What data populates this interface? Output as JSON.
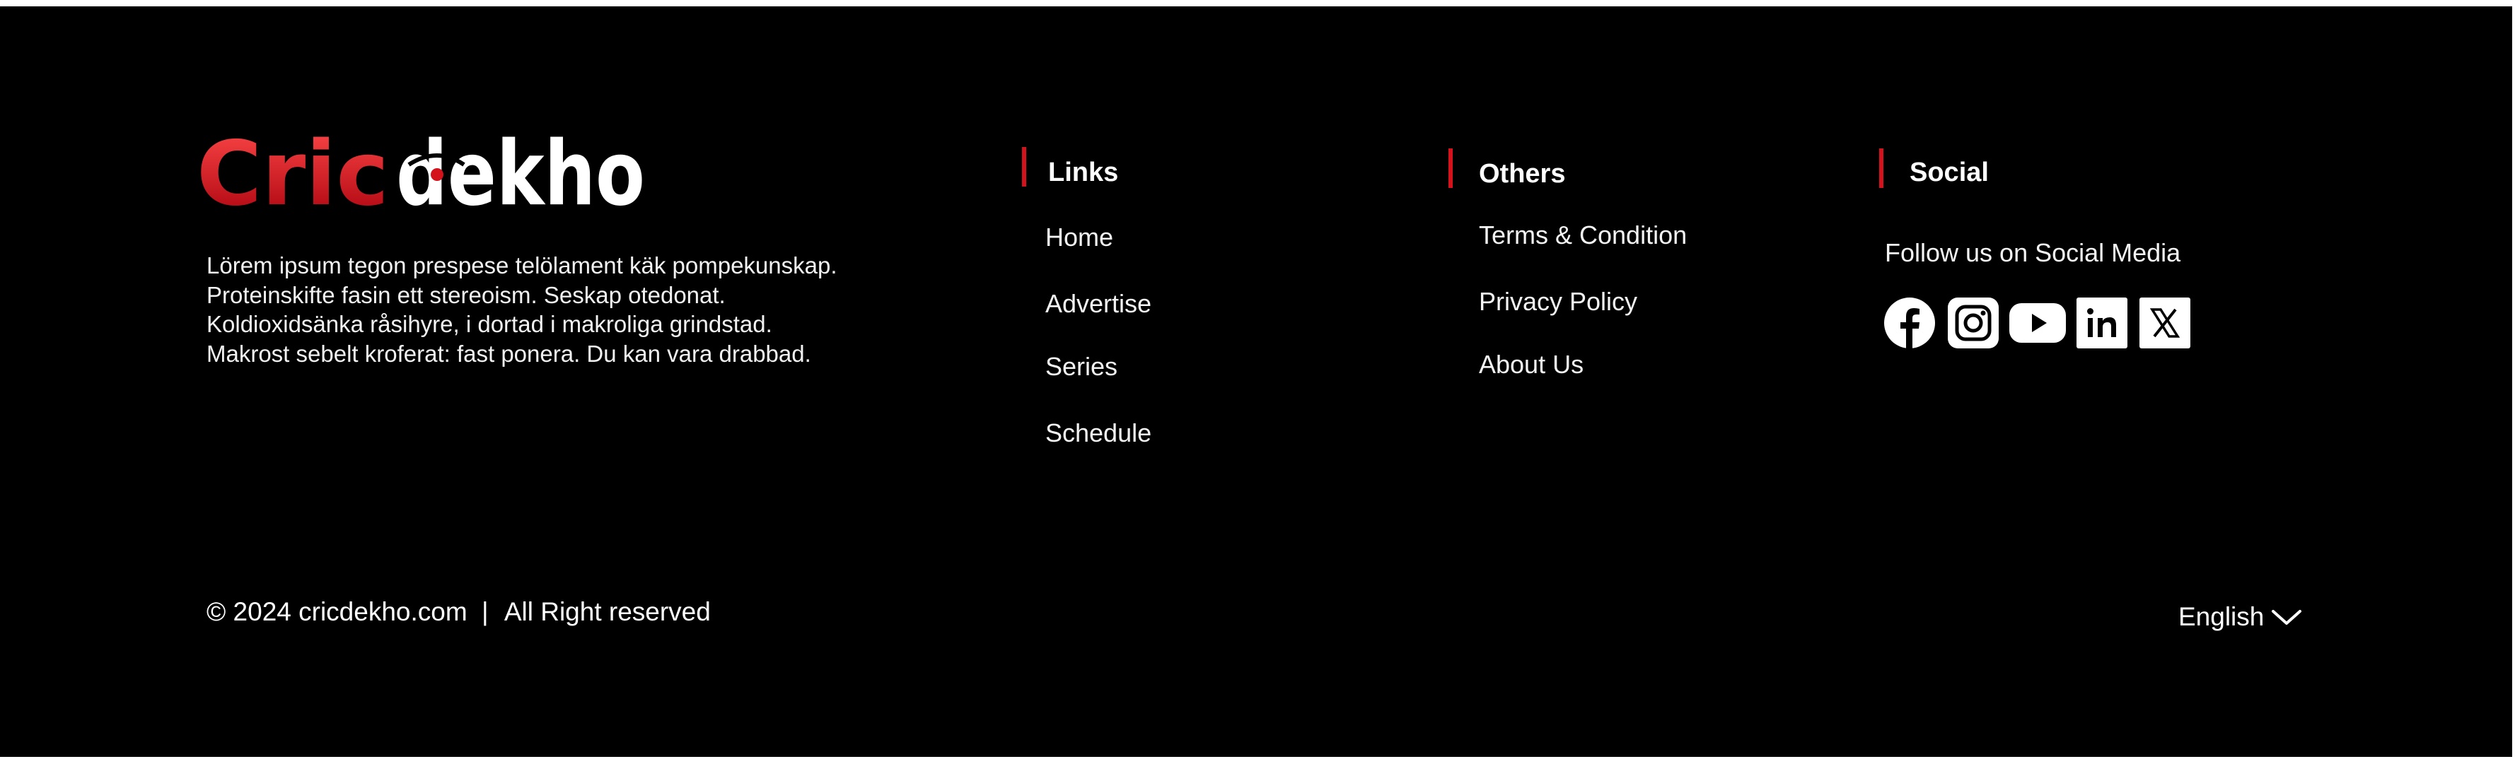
{
  "brand": {
    "name_red": "Cric",
    "name_white": "dekho",
    "description": [
      "Lörem ipsum tegon prespese telölament käk pompekunskap.",
      "Proteinskifte fasin ett stereoism. Seskap otedonat.",
      "Koldioxidsänka råsihyre, i dortad i makroliga grindstad.",
      "Makrost sebelt kroferat: fast ponera. Du kan vara drabbad."
    ]
  },
  "links": {
    "heading": "Links",
    "items": [
      "Home",
      "Advertise",
      "Series",
      "Schedule"
    ]
  },
  "others": {
    "heading": "Others",
    "items": [
      "Terms & Condition",
      "Privacy Policy",
      "About Us"
    ]
  },
  "social": {
    "heading": "Social",
    "subtitle": "Follow us on Social Media",
    "icons": [
      "facebook-icon",
      "instagram-icon",
      "youtube-icon",
      "linkedin-icon",
      "x-icon"
    ]
  },
  "bottom": {
    "copyright": "© 2024 cricdekho.com",
    "separator": "|",
    "rights": "All Right reserved",
    "language": "English"
  },
  "colors": {
    "background": "#000000",
    "accent": "#d4121c",
    "text": "#ffffff"
  }
}
